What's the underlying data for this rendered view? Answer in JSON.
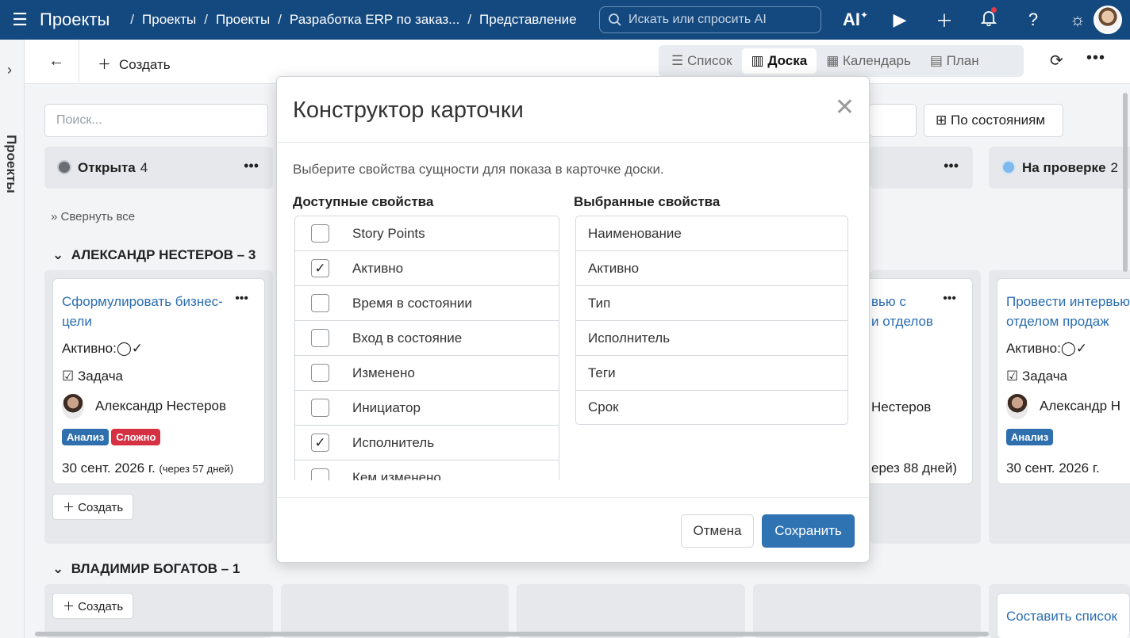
{
  "topbar": {
    "app_title": "Проекты",
    "crumbs": [
      "Проекты",
      "Проекты",
      "Разработка ERP по заказ...",
      "Представление"
    ],
    "search_placeholder": "Искать или спросить AI",
    "ai_label": "AI"
  },
  "rail": {
    "label": "Проекты"
  },
  "toolbar": {
    "create_label": "Создать",
    "views": [
      "Список",
      "Доска",
      "Календарь",
      "План"
    ],
    "active_view": "Доска"
  },
  "board": {
    "filter_placeholder": "Поиск...",
    "states_button": "По состояниям",
    "columns": [
      {
        "name": "Открыта",
        "count": "4",
        "dot_color": "#6b6f75"
      },
      {
        "name": "На проверке",
        "count": "2",
        "dot_color": "#7fb8ec"
      }
    ],
    "collapse_all": "Свернуть все",
    "groups": [
      "АЛЕКСАНДР НЕСТЕРОВ – 3",
      "ВЛАДИМИР БОГАТОВ – 1"
    ],
    "cards": [
      {
        "title": "Сформулировать бизнес-цели",
        "active": "Активно:",
        "type": "Задача",
        "assignee": "Александр Нестеров",
        "tags": [
          "Анализ",
          "Сложно"
        ],
        "due": "30 сент. 2026 г.",
        "due_hint": "(через 57 дней)"
      },
      {
        "title_tail_1": "вью с",
        "title_tail_2": "и отделов",
        "assignee_tail": "Нестеров",
        "due_hint_tail": "ерез 88 дней)"
      },
      {
        "title": "Провести интервью с отделом продаж",
        "active": "Активно:",
        "type": "Задача",
        "assignee": "Александр Н",
        "tags": [
          "Анализ"
        ],
        "due": "30 сент. 2026 г."
      },
      {
        "title": "Составить список"
      }
    ],
    "add_label": "Создать"
  },
  "modal": {
    "title": "Конструктор карточки",
    "description": "Выберите свойства сущности для показа в карточке доски.",
    "available_label": "Доступные свойства",
    "selected_label": "Выбранные свойства",
    "available": [
      {
        "label": "Story Points",
        "checked": false
      },
      {
        "label": "Активно",
        "checked": true
      },
      {
        "label": "Время в состоянии",
        "checked": false
      },
      {
        "label": "Вход в состояние",
        "checked": false
      },
      {
        "label": "Изменено",
        "checked": false
      },
      {
        "label": "Инициатор",
        "checked": false
      },
      {
        "label": "Исполнитель",
        "checked": true
      },
      {
        "label": "Кем изменено",
        "checked": false
      }
    ],
    "selected": [
      "Наименование",
      "Активно",
      "Тип",
      "Исполнитель",
      "Теги",
      "Срок"
    ],
    "cancel_label": "Отмена",
    "save_label": "Сохранить"
  },
  "colors": {
    "topbar": "#14497f",
    "accent": "#2f73b3",
    "tag_blue": "#2f6fae",
    "tag_red": "#d63143"
  }
}
